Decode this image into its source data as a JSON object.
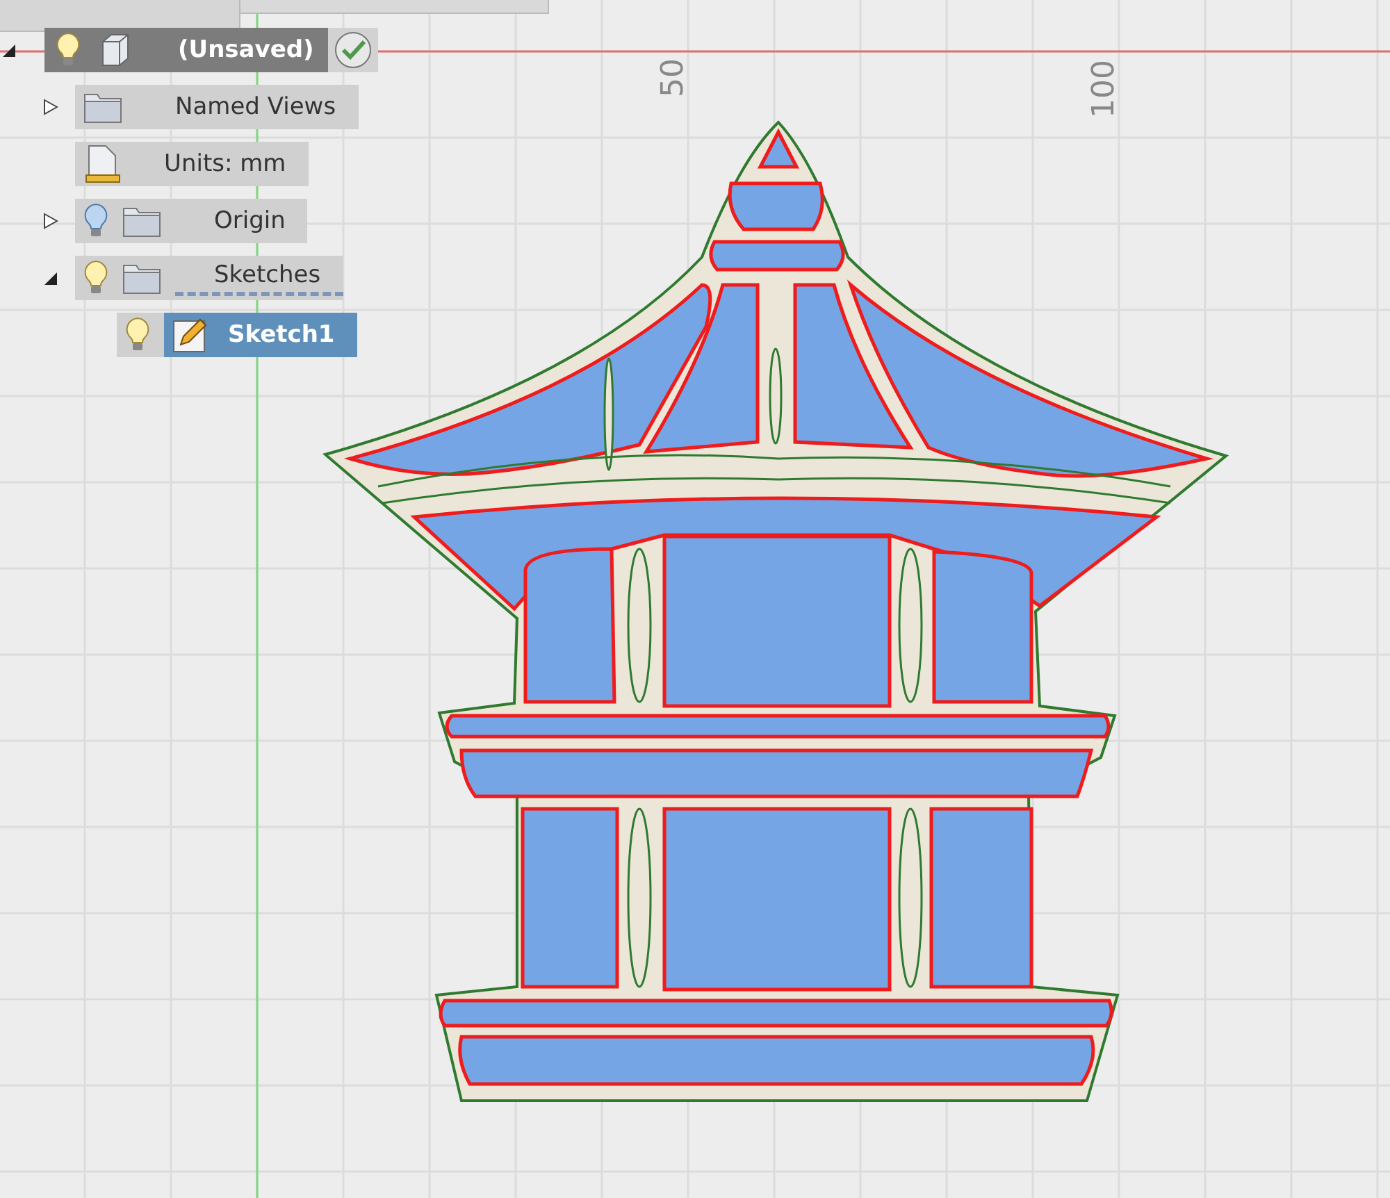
{
  "browser": {
    "root": {
      "label": "(Unsaved)",
      "expanded": true,
      "visible": true,
      "saved": false,
      "selected": false,
      "children": [
        {
          "kind": "folder",
          "label": "Named Views",
          "expanded": false,
          "selected": false
        },
        {
          "kind": "units",
          "label": "Units: mm",
          "selected": false
        },
        {
          "kind": "folder",
          "label": "Origin",
          "expanded": false,
          "visible": false,
          "selected": false
        },
        {
          "kind": "folder",
          "label": "Sketches",
          "expanded": true,
          "visible": true,
          "selected": false,
          "children": [
            {
              "kind": "sketch",
              "label": "Sketch1",
              "visible": true,
              "selected": true
            }
          ]
        }
      ]
    }
  },
  "canvas": {
    "axis_labels": [
      "50",
      "100"
    ]
  }
}
